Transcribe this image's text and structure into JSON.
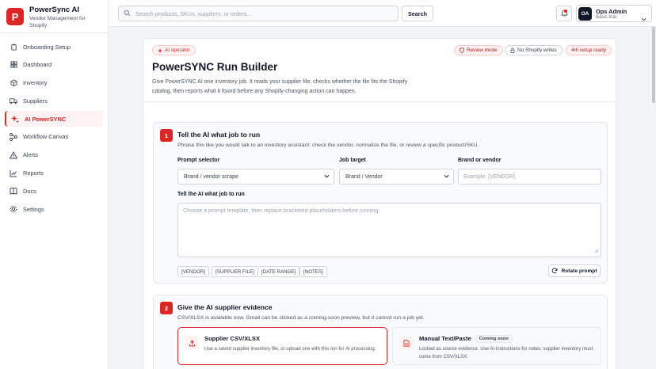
{
  "brand": {
    "logo": "P",
    "name": "PowerSync AI",
    "subtitle": "Vendor Management for Shopify"
  },
  "sidebar": {
    "items": [
      {
        "label": "Onboarding Setup",
        "icon": "clipboard-icon",
        "active": false
      },
      {
        "label": "Dashboard",
        "icon": "grid-icon",
        "active": false
      },
      {
        "label": "Inventory",
        "icon": "box-icon",
        "active": false
      },
      {
        "label": "Suppliers",
        "icon": "truck-icon",
        "active": false
      },
      {
        "label": "AI PowerSYNC",
        "icon": "sparkle-icon",
        "active": true
      },
      {
        "label": "Workflow Canvas",
        "icon": "workflow-icon",
        "active": false
      },
      {
        "label": "Alerts",
        "icon": "alert-icon",
        "active": false
      },
      {
        "label": "Reports",
        "icon": "chart-icon",
        "active": false
      },
      {
        "label": "Docs",
        "icon": "book-icon",
        "active": false
      },
      {
        "label": "Settings",
        "icon": "gear-icon",
        "active": false
      }
    ]
  },
  "topbar": {
    "search_placeholder": "Search products, SKUs, suppliers, or orders...",
    "search_button": "Search",
    "user_initials": "OA",
    "user_name": "Ops Admin",
    "user_plan": "Basic trial"
  },
  "colors": {
    "accent": "#dc2626",
    "accent_soft": "#fef2f2"
  },
  "page": {
    "badge": "AI operator",
    "review_mode": "Review mode",
    "no_writes": "No Shopify writes",
    "setup_status": "4/6 setup ready",
    "title": "PowerSYNC Run Builder",
    "description": "Give PowerSYNC AI one inventory job. It reads your supplier file, checks whether the file fits the Shopify catalog, then reports what it found before any Shopify-changing action can happen."
  },
  "step1": {
    "number": "1",
    "title": "Tell the AI what job to run",
    "description": "Phrase this like you would talk to an inventory assistant: check the vendor, normalize the file, or review a specific product/SKU.",
    "prompt_selector_label": "Prompt selector",
    "prompt_selector_value": "Brand / vendor scrape",
    "job_target_label": "Job target",
    "job_target_value": "Brand / Vendor",
    "brand_label": "Brand or vendor",
    "brand_placeholder": "Example: [VENDOR]",
    "job_label": "Tell the AI what job to run",
    "job_placeholder": "Choose a prompt template, then replace bracketed placeholders before running.",
    "chips": [
      "[VENDOR]",
      "[SUPPLIER FILE]",
      "[DATE RANGE]",
      "[NOTES]"
    ],
    "rotate_button": "Rotate prompt"
  },
  "step2": {
    "number": "2",
    "title": "Give the AI supplier evidence",
    "description": "CSV/XLSX is available now. Gmail can be clicked as a coming-soon preview, but it cannot run a job yet.",
    "source_csv_title": "Supplier CSV/XLSX",
    "source_csv_desc": "Use a saved supplier inventory file, or upload one with this run for AI processing.",
    "source_manual_title": "Manual Text/Paste",
    "source_manual_badge": "Coming soon",
    "source_manual_desc": "Locked as source evidence. Use AI instructions for notes; supplier inventory must come from CSV/XLSX."
  }
}
